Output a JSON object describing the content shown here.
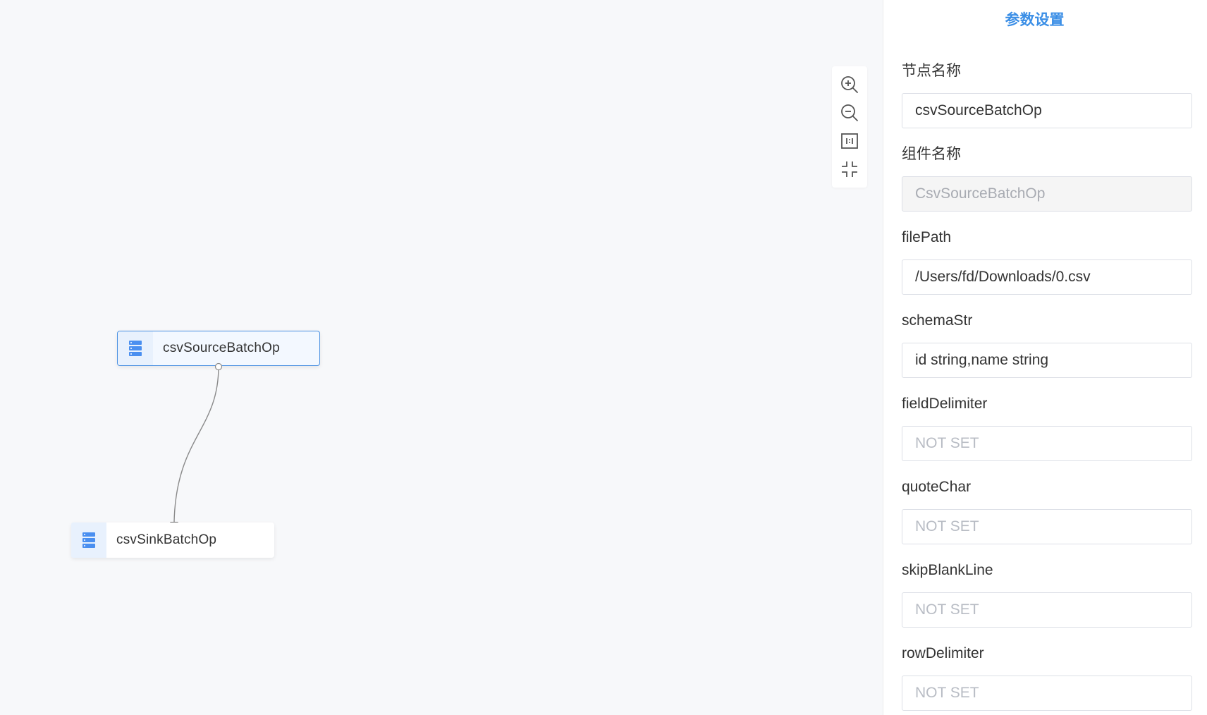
{
  "canvas": {
    "toolbar": {
      "zoom_in": "zoom-in-icon",
      "zoom_out": "zoom-out-icon",
      "actual_size": "actual-size-icon",
      "fit": "fit-view-icon"
    },
    "nodes": [
      {
        "label": "csvSourceBatchOp",
        "icon": "database-icon",
        "selected": true
      },
      {
        "label": "csvSinkBatchOp",
        "icon": "database-icon",
        "selected": false
      }
    ]
  },
  "panel": {
    "title": "参数设置",
    "fields": [
      {
        "label": "节点名称",
        "value": "csvSourceBatchOp",
        "placeholder": "",
        "disabled": false
      },
      {
        "label": "组件名称",
        "value": "CsvSourceBatchOp",
        "placeholder": "",
        "disabled": true
      },
      {
        "label": "filePath",
        "value": "/Users/fd/Downloads/0.csv",
        "placeholder": "",
        "disabled": false
      },
      {
        "label": "schemaStr",
        "value": "id string,name string",
        "placeholder": "",
        "disabled": false
      },
      {
        "label": "fieldDelimiter",
        "value": "",
        "placeholder": "NOT SET",
        "disabled": false
      },
      {
        "label": "quoteChar",
        "value": "",
        "placeholder": "NOT SET",
        "disabled": false
      },
      {
        "label": "skipBlankLine",
        "value": "",
        "placeholder": "NOT SET",
        "disabled": false
      },
      {
        "label": "rowDelimiter",
        "value": "",
        "placeholder": "NOT SET",
        "disabled": false
      }
    ]
  },
  "colors": {
    "accent": "#3a8ee6",
    "node_icon": "#4a8ff0",
    "canvas_bg": "#f7f8fa"
  }
}
